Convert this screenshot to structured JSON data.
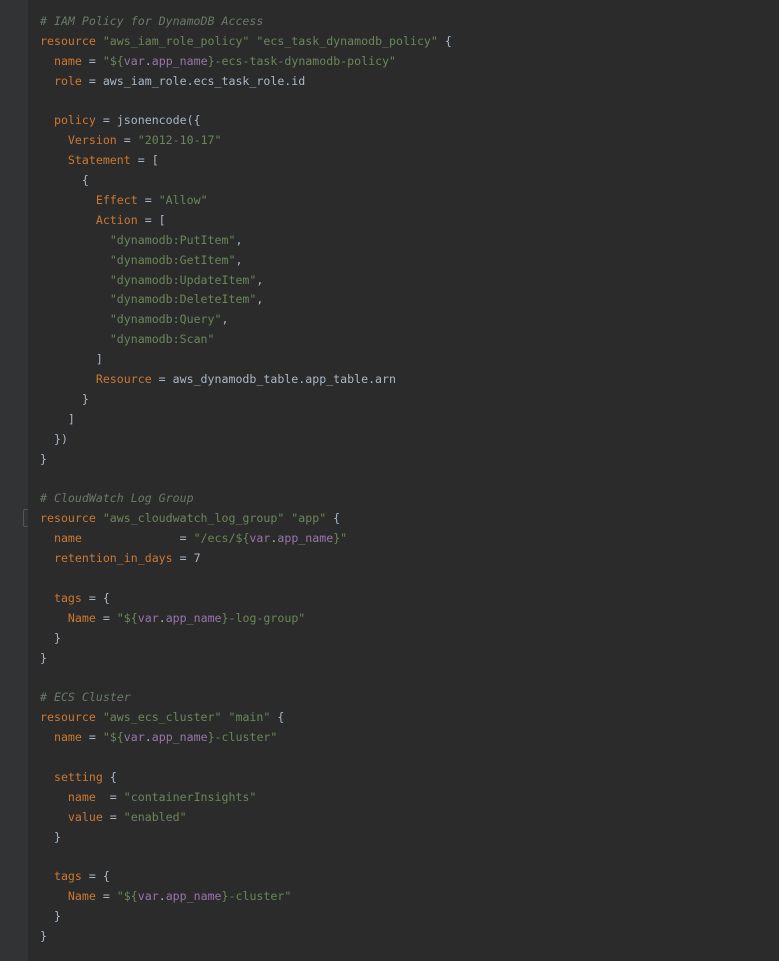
{
  "editor": {
    "language": "terraform",
    "lines": [
      [
        {
          "t": "# IAM Policy for DynamoDB Access",
          "c": "cmt"
        }
      ],
      [
        {
          "t": "resource",
          "c": "kw"
        },
        {
          "t": " ",
          "c": "plain"
        },
        {
          "t": "\"aws_iam_role_policy\"",
          "c": "str"
        },
        {
          "t": " ",
          "c": "plain"
        },
        {
          "t": "\"ecs_task_dynamodb_policy\"",
          "c": "str"
        },
        {
          "t": " {",
          "c": "plain"
        }
      ],
      [
        {
          "t": "  ",
          "c": "plain"
        },
        {
          "t": "name",
          "c": "prop"
        },
        {
          "t": " = ",
          "c": "plain"
        },
        {
          "t": "\"${",
          "c": "str"
        },
        {
          "t": "var",
          "c": "var"
        },
        {
          "t": ".",
          "c": "plain"
        },
        {
          "t": "app_name",
          "c": "var"
        },
        {
          "t": "}-ecs-task-dynamodb-policy\"",
          "c": "str"
        }
      ],
      [
        {
          "t": "  ",
          "c": "plain"
        },
        {
          "t": "role",
          "c": "prop"
        },
        {
          "t": " = aws_iam_role.ecs_task_role.id",
          "c": "plain"
        }
      ],
      [],
      [
        {
          "t": "  ",
          "c": "plain"
        },
        {
          "t": "policy",
          "c": "prop"
        },
        {
          "t": " = jsonencode({",
          "c": "plain"
        }
      ],
      [
        {
          "t": "    ",
          "c": "plain"
        },
        {
          "t": "Version",
          "c": "prop"
        },
        {
          "t": " = ",
          "c": "plain"
        },
        {
          "t": "\"2012-10-17\"",
          "c": "str"
        }
      ],
      [
        {
          "t": "    ",
          "c": "plain"
        },
        {
          "t": "Statement",
          "c": "prop"
        },
        {
          "t": " = [",
          "c": "plain"
        }
      ],
      [
        {
          "t": "      {",
          "c": "plain"
        }
      ],
      [
        {
          "t": "        ",
          "c": "plain"
        },
        {
          "t": "Effect",
          "c": "prop"
        },
        {
          "t": " = ",
          "c": "plain"
        },
        {
          "t": "\"Allow\"",
          "c": "str"
        }
      ],
      [
        {
          "t": "        ",
          "c": "plain"
        },
        {
          "t": "Action",
          "c": "prop"
        },
        {
          "t": " = [",
          "c": "plain"
        }
      ],
      [
        {
          "t": "          ",
          "c": "plain"
        },
        {
          "t": "\"dynamodb:PutItem\"",
          "c": "str"
        },
        {
          "t": ",",
          "c": "plain"
        }
      ],
      [
        {
          "t": "          ",
          "c": "plain"
        },
        {
          "t": "\"dynamodb:GetItem\"",
          "c": "str"
        },
        {
          "t": ",",
          "c": "plain"
        }
      ],
      [
        {
          "t": "          ",
          "c": "plain"
        },
        {
          "t": "\"dynamodb:UpdateItem\"",
          "c": "str"
        },
        {
          "t": ",",
          "c": "plain"
        }
      ],
      [
        {
          "t": "          ",
          "c": "plain"
        },
        {
          "t": "\"dynamodb:DeleteItem\"",
          "c": "str"
        },
        {
          "t": ",",
          "c": "plain"
        }
      ],
      [
        {
          "t": "          ",
          "c": "plain"
        },
        {
          "t": "\"dynamodb:Query\"",
          "c": "str"
        },
        {
          "t": ",",
          "c": "plain"
        }
      ],
      [
        {
          "t": "          ",
          "c": "plain"
        },
        {
          "t": "\"dynamodb:Scan\"",
          "c": "str"
        }
      ],
      [
        {
          "t": "        ]",
          "c": "plain"
        }
      ],
      [
        {
          "t": "        ",
          "c": "plain"
        },
        {
          "t": "Resource",
          "c": "prop"
        },
        {
          "t": " = aws_dynamodb_table.app_table.arn",
          "c": "plain"
        }
      ],
      [
        {
          "t": "      }",
          "c": "plain"
        }
      ],
      [
        {
          "t": "    ]",
          "c": "plain"
        }
      ],
      [
        {
          "t": "  })",
          "c": "plain"
        }
      ],
      [
        {
          "t": "}",
          "c": "plain"
        }
      ],
      [],
      [
        {
          "t": "# CloudWatch Log Group",
          "c": "cmt"
        }
      ],
      [
        {
          "t": "resource",
          "c": "kw"
        },
        {
          "t": " ",
          "c": "plain"
        },
        {
          "t": "\"aws_cloudwatch_log_group\"",
          "c": "str"
        },
        {
          "t": " ",
          "c": "plain"
        },
        {
          "t": "\"app\"",
          "c": "str"
        },
        {
          "t": " {",
          "c": "plain"
        }
      ],
      [
        {
          "t": "  ",
          "c": "plain"
        },
        {
          "t": "name",
          "c": "prop"
        },
        {
          "t": "              = ",
          "c": "plain"
        },
        {
          "t": "\"/ecs/${",
          "c": "str"
        },
        {
          "t": "var",
          "c": "var"
        },
        {
          "t": ".",
          "c": "plain"
        },
        {
          "t": "app_name",
          "c": "var"
        },
        {
          "t": "}\"",
          "c": "str"
        }
      ],
      [
        {
          "t": "  ",
          "c": "plain"
        },
        {
          "t": "retention_in_days",
          "c": "prop"
        },
        {
          "t": " = 7",
          "c": "plain"
        }
      ],
      [],
      [
        {
          "t": "  ",
          "c": "plain"
        },
        {
          "t": "tags",
          "c": "prop"
        },
        {
          "t": " = {",
          "c": "plain"
        }
      ],
      [
        {
          "t": "    ",
          "c": "plain"
        },
        {
          "t": "Name",
          "c": "prop"
        },
        {
          "t": " = ",
          "c": "plain"
        },
        {
          "t": "\"${",
          "c": "str"
        },
        {
          "t": "var",
          "c": "var"
        },
        {
          "t": ".",
          "c": "plain"
        },
        {
          "t": "app_name",
          "c": "var"
        },
        {
          "t": "}-log-group\"",
          "c": "str"
        }
      ],
      [
        {
          "t": "  }",
          "c": "plain"
        }
      ],
      [
        {
          "t": "}",
          "c": "plain"
        }
      ],
      [],
      [
        {
          "t": "# ECS Cluster",
          "c": "cmt"
        }
      ],
      [
        {
          "t": "resource",
          "c": "kw"
        },
        {
          "t": " ",
          "c": "plain"
        },
        {
          "t": "\"aws_ecs_cluster\"",
          "c": "str"
        },
        {
          "t": " ",
          "c": "plain"
        },
        {
          "t": "\"main\"",
          "c": "str"
        },
        {
          "t": " {",
          "c": "plain"
        }
      ],
      [
        {
          "t": "  ",
          "c": "plain"
        },
        {
          "t": "name",
          "c": "prop"
        },
        {
          "t": " = ",
          "c": "plain"
        },
        {
          "t": "\"${",
          "c": "str"
        },
        {
          "t": "var",
          "c": "var"
        },
        {
          "t": ".",
          "c": "plain"
        },
        {
          "t": "app_name",
          "c": "var"
        },
        {
          "t": "}-cluster\"",
          "c": "str"
        }
      ],
      [],
      [
        {
          "t": "  ",
          "c": "plain"
        },
        {
          "t": "setting",
          "c": "prop"
        },
        {
          "t": " {",
          "c": "plain"
        }
      ],
      [
        {
          "t": "    ",
          "c": "plain"
        },
        {
          "t": "name",
          "c": "prop"
        },
        {
          "t": "  = ",
          "c": "plain"
        },
        {
          "t": "\"containerInsights\"",
          "c": "str"
        }
      ],
      [
        {
          "t": "    ",
          "c": "plain"
        },
        {
          "t": "value",
          "c": "prop"
        },
        {
          "t": " = ",
          "c": "plain"
        },
        {
          "t": "\"enabled\"",
          "c": "str"
        }
      ],
      [
        {
          "t": "  }",
          "c": "plain"
        }
      ],
      [],
      [
        {
          "t": "  ",
          "c": "plain"
        },
        {
          "t": "tags",
          "c": "prop"
        },
        {
          "t": " = {",
          "c": "plain"
        }
      ],
      [
        {
          "t": "    ",
          "c": "plain"
        },
        {
          "t": "Name",
          "c": "prop"
        },
        {
          "t": " = ",
          "c": "plain"
        },
        {
          "t": "\"${",
          "c": "str"
        },
        {
          "t": "var",
          "c": "var"
        },
        {
          "t": ".",
          "c": "plain"
        },
        {
          "t": "app_name",
          "c": "var"
        },
        {
          "t": "}-cluster\"",
          "c": "str"
        }
      ],
      [
        {
          "t": "  }",
          "c": "plain"
        }
      ],
      [
        {
          "t": "}",
          "c": "plain"
        }
      ]
    ]
  },
  "colors": {
    "background": "#2b2b2b",
    "gutter": "#313335",
    "comment": "#6a7a6a",
    "keyword": "#cc7832",
    "string": "#6a8759",
    "variable": "#9876aa",
    "plain": "#a9b7c6"
  }
}
